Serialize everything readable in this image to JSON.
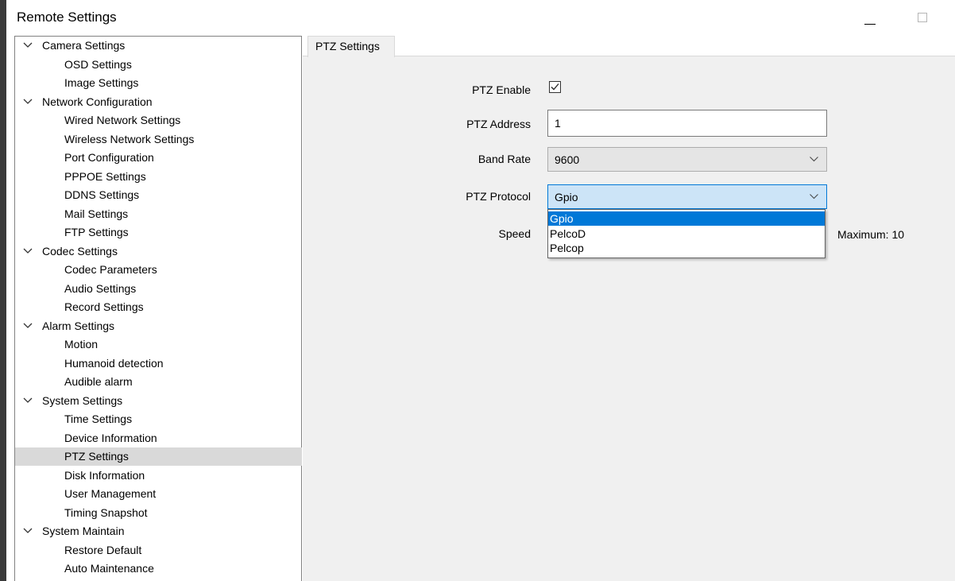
{
  "window": {
    "title": "Remote Settings"
  },
  "tree": [
    {
      "label": "Camera Settings",
      "children": [
        "OSD Settings",
        "Image Settings"
      ]
    },
    {
      "label": "Network Configuration",
      "children": [
        "Wired Network Settings",
        "Wireless Network Settings",
        "Port Configuration",
        "PPPOE Settings",
        "DDNS Settings",
        "Mail Settings",
        "FTP Settings"
      ]
    },
    {
      "label": "Codec Settings",
      "children": [
        "Codec Parameters",
        "Audio Settings",
        "Record Settings"
      ]
    },
    {
      "label": "Alarm Settings",
      "children": [
        "Motion",
        "Humanoid detection",
        "Audible alarm"
      ]
    },
    {
      "label": "System Settings",
      "children": [
        "Time Settings",
        "Device Information",
        "PTZ Settings",
        "Disk Information",
        "User Management",
        "Timing Snapshot"
      ]
    },
    {
      "label": "System Maintain",
      "children": [
        "Restore Default",
        "Auto Maintenance"
      ]
    }
  ],
  "selected": "PTZ Settings",
  "tab": {
    "label": "PTZ Settings"
  },
  "form": {
    "ptz_enable_label": "PTZ Enable",
    "ptz_enable_checked": true,
    "ptz_address_label": "PTZ Address",
    "ptz_address_value": "1",
    "band_rate_label": "Band Rate",
    "band_rate_value": "9600",
    "ptz_protocol_label": "PTZ Protocol",
    "ptz_protocol_value": "Gpio",
    "protocol_options": [
      "Gpio",
      "PelcoD",
      "Pelcop"
    ],
    "speed_label": "Speed",
    "maximum_label": "Maximum: 10"
  },
  "colors": {
    "accent": "#0078d7",
    "combo_focus_bg": "#cce4f7",
    "selection_bg": "#d9d9d9",
    "panel_bg": "#f0f0f0"
  }
}
